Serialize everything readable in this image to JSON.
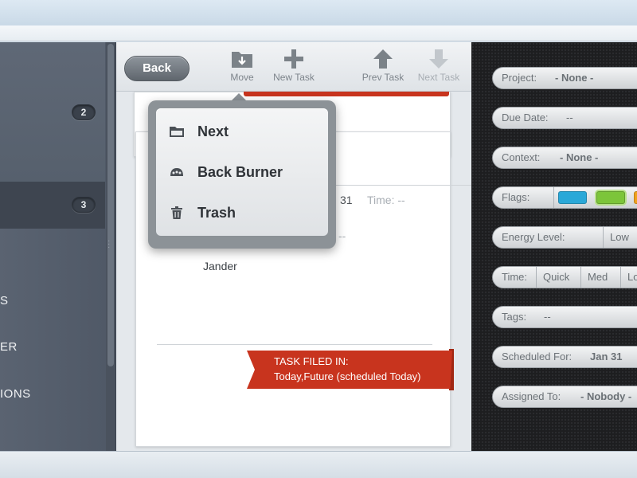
{
  "sidebar": {
    "items": [
      {
        "count": "2"
      },
      {
        "count": "3"
      }
    ],
    "text_fragments": [
      "S",
      "ER",
      "IONS"
    ]
  },
  "toolbar": {
    "back_label": "Back",
    "move_label": "Move",
    "new_task_label": "New Task",
    "prev_task_label": "Prev Task",
    "next_task_label": "Next Task"
  },
  "task_card": {
    "date_fragment": "31",
    "time_label": "Time: --",
    "dash_fragment": "--",
    "assignee": "Jander",
    "filed_in_label": "TASK FILED IN:",
    "filed_in_value": "Today,Future (scheduled Today)"
  },
  "move_menu": {
    "items": [
      {
        "label": "Next",
        "icon": "folder-icon"
      },
      {
        "label": "Back Burner",
        "icon": "back-burner-icon"
      },
      {
        "label": "Trash",
        "icon": "trash-icon"
      }
    ]
  },
  "details": {
    "project_label": "Project:",
    "project_value": "- None -",
    "due_date_label": "Due Date:",
    "due_date_value": "--",
    "context_label": "Context:",
    "context_value": "- None -",
    "flags_label": "Flags:",
    "flags_colors": [
      "#2aa8d8",
      "#7cc53a",
      "#f0a21e"
    ],
    "energy_label": "Energy Level:",
    "energy_value": "Low",
    "time_label": "Time:",
    "time_options": [
      "Quick",
      "Med",
      "Lo"
    ],
    "tags_label": "Tags:",
    "tags_value": "--",
    "scheduled_label": "Scheduled For:",
    "scheduled_value": "Jan 31",
    "assigned_label": "Assigned To:",
    "assigned_value": "- Nobody -"
  },
  "colors": {
    "ribbon": "#c8341e",
    "sidebar": "#535c69",
    "panel_dark": "#1d1e20"
  }
}
